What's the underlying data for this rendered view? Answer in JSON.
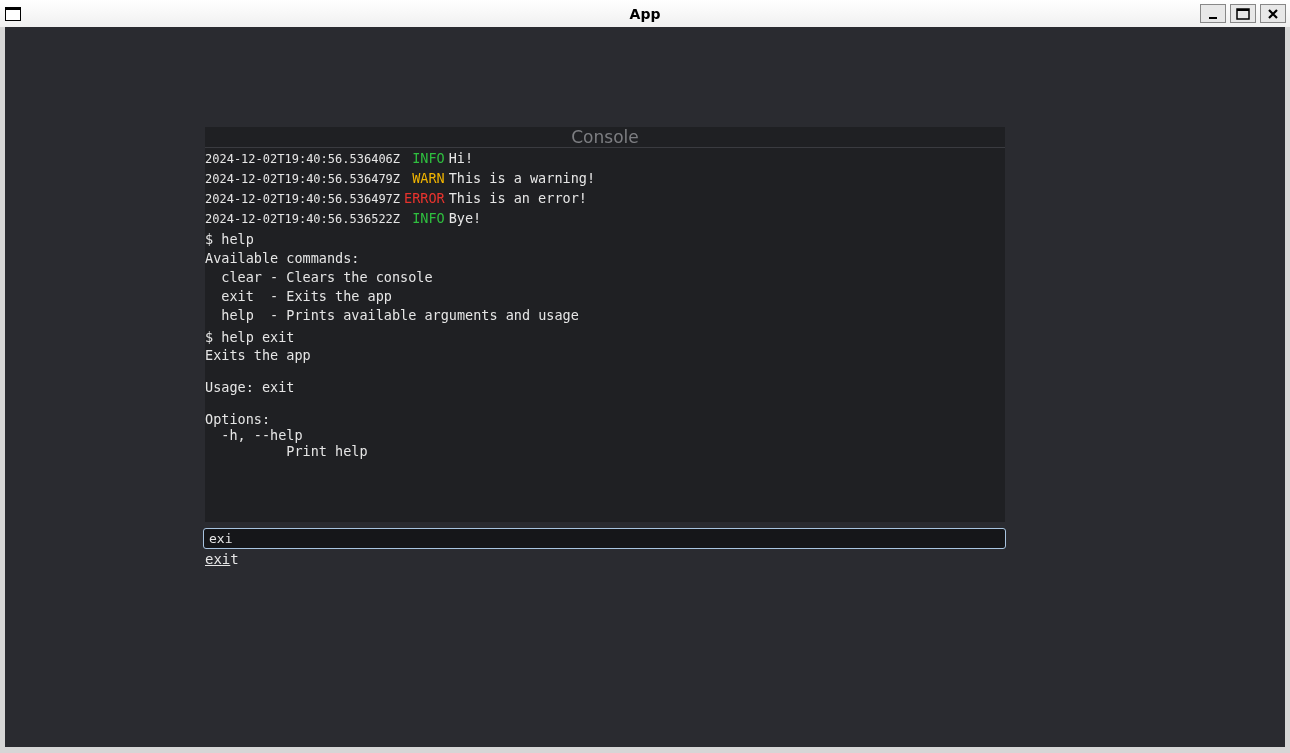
{
  "window": {
    "title": "App"
  },
  "console": {
    "title": "Console",
    "lines": [
      {
        "kind": "log",
        "timestamp": "2024-12-02T19:40:56.536406Z",
        "level": " INFO",
        "color": "#2fbf3f",
        "message": "Hi!"
      },
      {
        "kind": "log",
        "timestamp": "2024-12-02T19:40:56.536479Z",
        "level": " WARN",
        "color": "#f0b400",
        "message": "This is a warning!"
      },
      {
        "kind": "log",
        "timestamp": "2024-12-02T19:40:56.536497Z",
        "level": "ERROR",
        "color": "#e8332d",
        "message": "This is an error!"
      },
      {
        "kind": "log",
        "timestamp": "2024-12-02T19:40:56.536522Z",
        "level": " INFO",
        "color": "#2fbf3f",
        "message": "Bye!"
      },
      {
        "kind": "command",
        "text": "$ help"
      },
      {
        "kind": "output",
        "text": "Available commands:\n  clear - Clears the console\n  exit  - Exits the app\n  help  - Prints available arguments and usage"
      },
      {
        "kind": "command",
        "text": "$ help exit"
      },
      {
        "kind": "output",
        "text": "Exits the app\n\nUsage: exit\n\nOptions:\n  -h, --help\n          Print help"
      }
    ],
    "input": {
      "value": "exi"
    },
    "suggestion": "exit"
  }
}
